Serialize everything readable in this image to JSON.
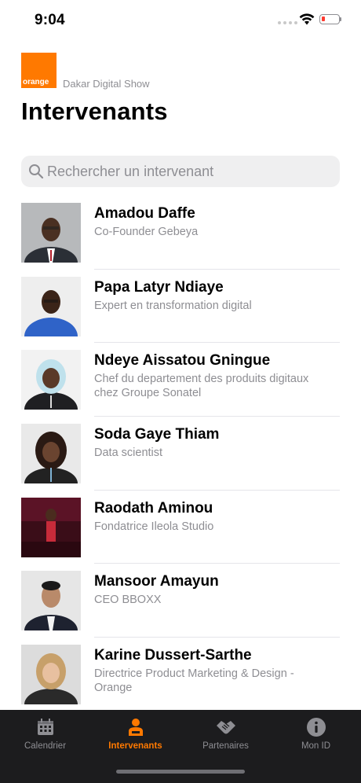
{
  "status_bar": {
    "time": "9:04"
  },
  "header": {
    "logo_text": "orange",
    "event_name": "Dakar Digital Show",
    "title": "Intervenants"
  },
  "search": {
    "placeholder": "Rechercher un intervenant",
    "value": ""
  },
  "speakers": [
    {
      "name": "Amadou Daffe",
      "subtitle": "Co-Founder Gebeya"
    },
    {
      "name": "Papa Latyr Ndiaye",
      "subtitle": "Expert en transformation digital"
    },
    {
      "name": "Ndeye Aissatou Gningue",
      "subtitle": "Chef du departement des produits digitaux chez Groupe Sonatel"
    },
    {
      "name": "Soda Gaye Thiam",
      "subtitle": "Data scientist"
    },
    {
      "name": "Raodath Aminou",
      "subtitle": "Fondatrice Ileola Studio"
    },
    {
      "name": "Mansoor Amayun",
      "subtitle": "CEO BBOXX"
    },
    {
      "name": "Karine Dussert-Sarthe",
      "subtitle": "Directrice Product Marketing & Design - Orange"
    }
  ],
  "tabs": [
    {
      "label": "Calendrier",
      "icon": "calendar-icon",
      "active": false
    },
    {
      "label": "Intervenants",
      "icon": "speaker-icon",
      "active": true
    },
    {
      "label": "Partenaires",
      "icon": "handshake-icon",
      "active": false
    },
    {
      "label": "Mon ID",
      "icon": "info-icon",
      "active": false
    }
  ],
  "colors": {
    "accent": "#ff7900",
    "tab_bar_bg": "#1c1c1e",
    "secondary_text": "#8e8e93"
  }
}
